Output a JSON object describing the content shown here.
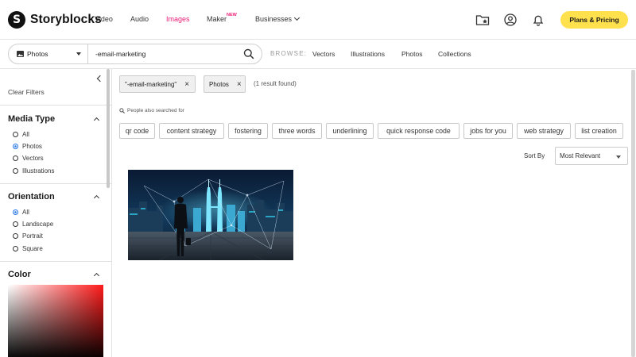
{
  "brand": {
    "name": "Storyblocks",
    "mark": "S"
  },
  "nav": {
    "video": "Video",
    "audio": "Audio",
    "images": "Images",
    "maker": "Maker",
    "maker_badge": "NEW",
    "businesses": "Businesses"
  },
  "header": {
    "plans_button": "Plans & Pricing"
  },
  "search": {
    "type_value": "Photos",
    "query": "-email-marketing",
    "browse_label": "BROWSE:",
    "browse_links": [
      "Vectors",
      "Illustrations",
      "Photos",
      "Collections"
    ]
  },
  "sidebar": {
    "clear_filters": "Clear Filters",
    "media_type": {
      "title": "Media Type",
      "options": [
        "All",
        "Photos",
        "Vectors",
        "Illustrations"
      ],
      "selected": "Photos"
    },
    "orientation": {
      "title": "Orientation",
      "options": [
        "All",
        "Landscape",
        "Portrait",
        "Square"
      ],
      "selected": "All"
    },
    "color": {
      "title": "Color"
    }
  },
  "filters": {
    "chips": [
      "\"-email-marketing\"",
      "Photos"
    ],
    "result_count": "(1 result found)"
  },
  "related": {
    "label": "People also searched for",
    "tags": [
      "qr code",
      "content strategy",
      "fostering",
      "three words",
      "underlining",
      "quick response code",
      "jobs for you",
      "web strategy",
      "list creation"
    ]
  },
  "sort": {
    "label": "Sort By",
    "value": "Most Relevant"
  },
  "colors": {
    "accent_pink": "#e91e78",
    "cta_yellow": "#ffe14d",
    "radio_blue": "#2d7be5"
  }
}
